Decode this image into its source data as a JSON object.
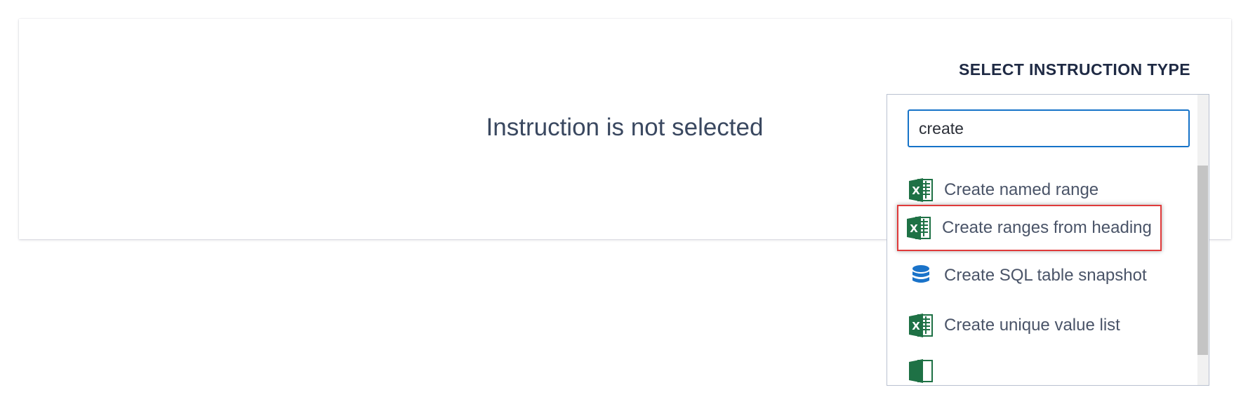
{
  "main": {
    "empty_message": "Instruction is not selected",
    "heading": "SELECT INSTRUCTION TYPE"
  },
  "search": {
    "value": "create"
  },
  "items": [
    {
      "label": "Create named range",
      "icon": "excel-icon"
    },
    {
      "label": "Create ranges from heading",
      "icon": "excel-icon",
      "highlighted": true
    },
    {
      "label": "Create SQL table snapshot",
      "icon": "database-icon"
    },
    {
      "label": "Create unique value list",
      "icon": "excel-icon"
    }
  ],
  "colors": {
    "excel_green": "#1e7145",
    "db_blue": "#1a73c9",
    "highlight_border": "#e03a3a",
    "focus_border": "#1673c8"
  }
}
